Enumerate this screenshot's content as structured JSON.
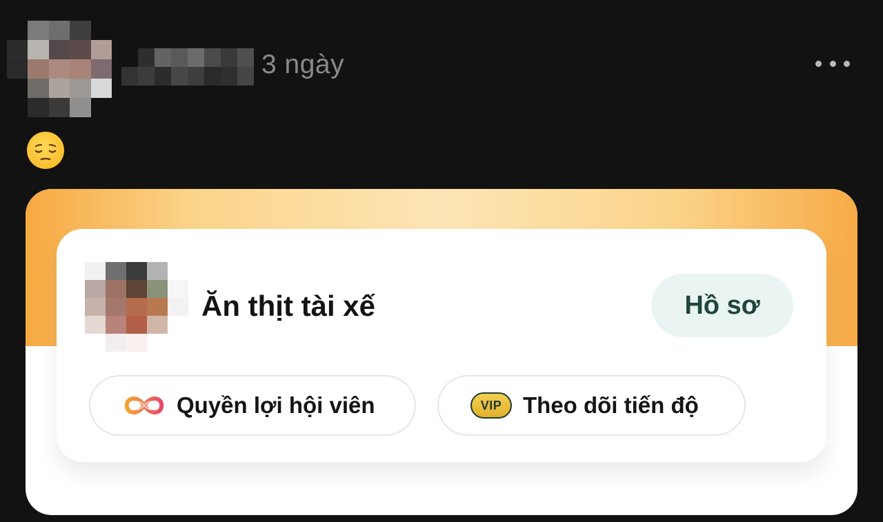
{
  "post": {
    "timestamp": "3 ngày",
    "more_icon": "more-horizontal-icon",
    "content_emoji": "pensive-face-emoji"
  },
  "shared_card": {
    "profile_name": "Ăn thịt tài xế",
    "profile_button_label": "Hồ sơ",
    "benefits_label": "Quyền lợi hội viên",
    "benefits_icon": "infinity-icon",
    "progress_label": "Theo dõi tiến độ",
    "progress_badge": "VIP",
    "colors": {
      "band_orange": "#f7a941",
      "band_light": "#fde5b6",
      "button_bg": "#eaf5f3",
      "button_text": "#21463f",
      "vip_gold": "#e2b02c"
    }
  }
}
